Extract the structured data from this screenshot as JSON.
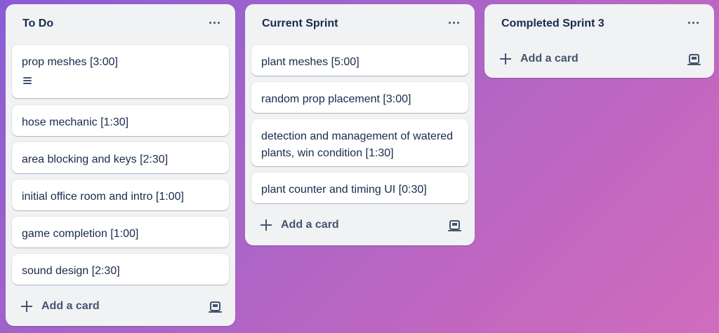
{
  "lists": [
    {
      "title": "To Do",
      "cards": [
        {
          "label": "prop meshes [3:00]",
          "has_description": true
        },
        {
          "label": "hose mechanic [1:30]"
        },
        {
          "label": "area blocking and keys [2:30]"
        },
        {
          "label": "initial office room and intro [1:00]"
        },
        {
          "label": "game completion [1:00]"
        },
        {
          "label": "sound design [2:30]"
        }
      ],
      "add_card_label": "Add a card"
    },
    {
      "title": "Current Sprint",
      "cards": [
        {
          "label": "plant meshes [5:00]"
        },
        {
          "label": "random prop placement [3:00]"
        },
        {
          "label": "detection and management of watered plants, win condition [1:30]"
        },
        {
          "label": "plant counter and timing UI [0:30]"
        }
      ],
      "add_card_label": "Add a card"
    },
    {
      "title": "Completed Sprint 3",
      "cards": [],
      "add_card_label": "Add a card"
    }
  ],
  "icons": {
    "list_menu": "more-horizontal-icon",
    "add": "plus-icon",
    "template": "card-template-icon",
    "description": "description-icon"
  },
  "colors": {
    "list_bg": "#f1f2f4",
    "card_bg": "#ffffff",
    "text": "#172b4d",
    "muted": "#44546f"
  }
}
